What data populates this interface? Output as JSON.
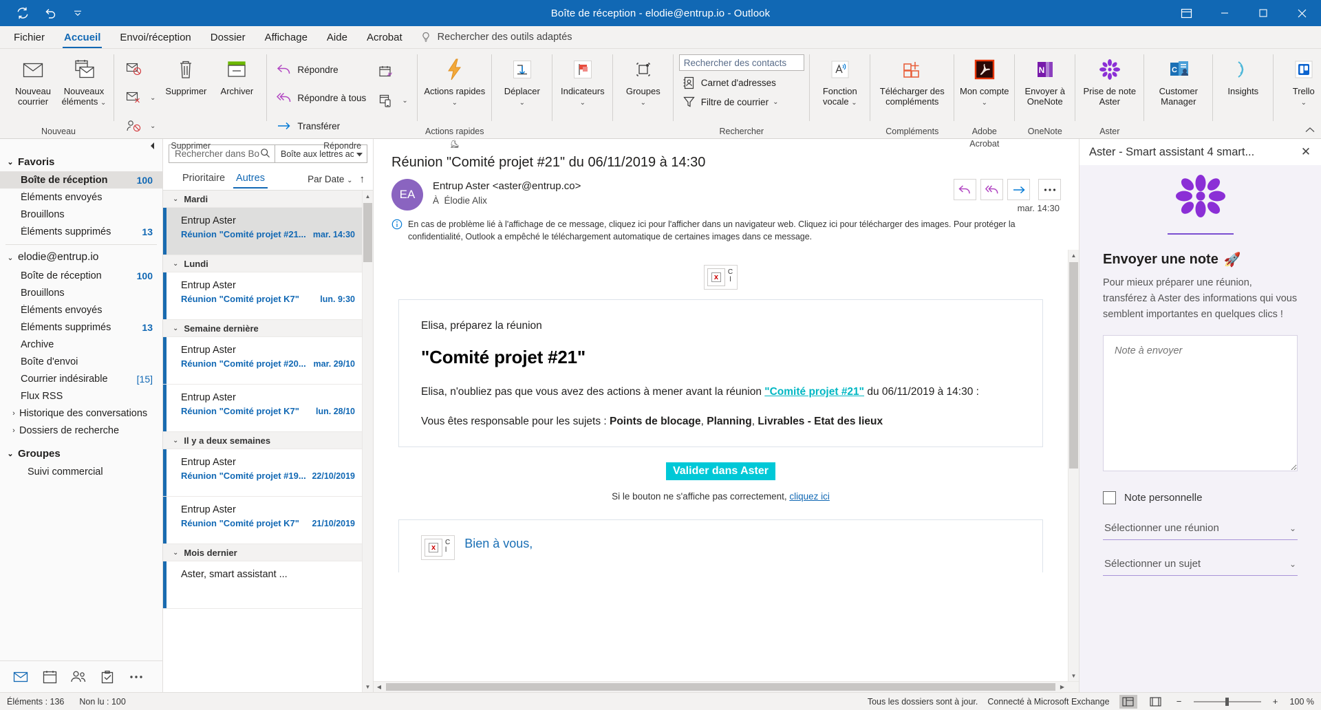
{
  "titlebar": {
    "title": "Boîte de réception - elodie@entrup.io  -  Outlook",
    "qat": {
      "sync": "sync-icon",
      "undo": "undo-icon",
      "more": "customize-quick-access-toolbar"
    },
    "controls": {
      "ribbon_display": "ribbon-display-options",
      "minimize": "minimize",
      "restore": "restore",
      "close": "close"
    }
  },
  "menubar": {
    "items": [
      {
        "label": "Fichier",
        "active": false
      },
      {
        "label": "Accueil",
        "active": true
      },
      {
        "label": "Envoi/réception",
        "active": false
      },
      {
        "label": "Dossier",
        "active": false
      },
      {
        "label": "Affichage",
        "active": false
      },
      {
        "label": "Aide",
        "active": false
      },
      {
        "label": "Acrobat",
        "active": false
      }
    ],
    "tell_me": "Rechercher des outils adaptés"
  },
  "ribbon": {
    "groups": [
      {
        "label": "Nouveau",
        "buttons": [
          {
            "label": "Nouveau courrier",
            "icon": "new-mail-icon"
          },
          {
            "label": "Nouveaux éléments",
            "icon": "new-items-icon",
            "dropdown": true
          }
        ]
      },
      {
        "label": "Supprimer",
        "buttons": [
          {
            "label": "Supprimer",
            "icon": "trash-icon"
          },
          {
            "label": "Archiver",
            "icon": "archive-icon"
          }
        ],
        "small": [
          {
            "label": "",
            "icon": "ignore-icon"
          },
          {
            "label": "",
            "icon": "junk-icon",
            "dropdown": true
          },
          {
            "label": "",
            "icon": "block-sender-icon",
            "dropdown": true
          }
        ]
      },
      {
        "label": "Répondre",
        "small": [
          {
            "label": "Répondre",
            "icon": "reply-icon"
          },
          {
            "label": "Répondre à tous",
            "icon": "reply-all-icon"
          },
          {
            "label": "Transférer",
            "icon": "forward-icon"
          }
        ],
        "stack": [
          {
            "icon": "meeting-reply-icon"
          },
          {
            "icon": "more-respond-icon",
            "dropdown": true
          }
        ]
      },
      {
        "label": "Actions rapides",
        "buttons": [
          {
            "label": "Actions rapides",
            "icon": "quick-steps-icon",
            "dropdown": true
          }
        ],
        "dialog_launcher": true
      },
      {
        "label": "",
        "buttons": [
          {
            "label": "Déplacer",
            "icon": "move-icon",
            "dropdown": true
          }
        ]
      },
      {
        "label": "",
        "buttons": [
          {
            "label": "Indicateurs",
            "icon": "flag-icon",
            "dropdown": true
          }
        ]
      },
      {
        "label": "",
        "buttons": [
          {
            "label": "Groupes",
            "icon": "groups-icon",
            "dropdown": true
          }
        ]
      },
      {
        "label": "Rechercher",
        "search_contacts_placeholder": "Rechercher des contacts",
        "small": [
          {
            "label": "Carnet d'adresses",
            "icon": "address-book-icon"
          },
          {
            "label": "Filtre de courrier",
            "icon": "filter-icon",
            "dropdown": true
          }
        ]
      },
      {
        "label": "",
        "buttons": [
          {
            "label": "Fonction vocale",
            "icon": "speech-icon",
            "dropdown": true
          }
        ]
      },
      {
        "label": "Compléments",
        "buttons": [
          {
            "label": "Télécharger des compléments",
            "icon": "get-addins-icon"
          }
        ]
      },
      {
        "label": "Adobe Acrobat",
        "buttons": [
          {
            "label": "Mon compte",
            "icon": "acrobat-icon",
            "dropdown": true
          }
        ]
      },
      {
        "label": "OneNote",
        "buttons": [
          {
            "label": "Envoyer à OneNote",
            "icon": "onenote-icon"
          }
        ]
      },
      {
        "label": "Aster",
        "buttons": [
          {
            "label": "Prise de note Aster",
            "icon": "aster-flower-icon"
          }
        ]
      },
      {
        "label": "",
        "buttons": [
          {
            "label": "Customer Manager",
            "icon": "customer-manager-icon"
          }
        ]
      },
      {
        "label": "",
        "buttons": [
          {
            "label": "Insights",
            "icon": "insights-icon"
          }
        ]
      },
      {
        "label": "",
        "buttons": [
          {
            "label": "Trello",
            "icon": "trello-icon",
            "dropdown": true
          }
        ]
      }
    ],
    "collapse": "collapse-ribbon-icon"
  },
  "folderpane": {
    "collapse_icon": "collapse-folder-pane-icon",
    "groups": [
      {
        "name": "Favoris",
        "expanded": true,
        "items": [
          {
            "label": "Boîte de réception",
            "count": "100",
            "selected": true
          },
          {
            "label": "Éléments envoyés",
            "count": ""
          },
          {
            "label": "Brouillons",
            "count": ""
          },
          {
            "label": "Éléments supprimés",
            "count": "13"
          }
        ]
      },
      {
        "name": "elodie@entrup.io",
        "expanded": true,
        "items": [
          {
            "label": "Boîte de réception",
            "count": "100"
          },
          {
            "label": "Brouillons",
            "count": ""
          },
          {
            "label": "Éléments envoyés",
            "count": ""
          },
          {
            "label": "Éléments supprimés",
            "count": "13"
          },
          {
            "label": "Archive",
            "count": ""
          },
          {
            "label": "Boîte d'envoi",
            "count": ""
          },
          {
            "label": "Courrier indésirable",
            "count": "[15]"
          },
          {
            "label": "Flux RSS",
            "count": ""
          },
          {
            "label": "Historique des conversations",
            "count": "",
            "expandable": true
          },
          {
            "label": "Dossiers de recherche",
            "count": "",
            "expandable": true
          }
        ]
      },
      {
        "name": "Groupes",
        "expanded": true,
        "items": [
          {
            "label": "Suivi commercial",
            "count": "",
            "sub": true
          }
        ]
      }
    ],
    "nav_buttons": [
      {
        "icon": "mail-nav-icon",
        "name": "mail"
      },
      {
        "icon": "calendar-nav-icon",
        "name": "calendar"
      },
      {
        "icon": "people-nav-icon",
        "name": "people"
      },
      {
        "icon": "tasks-nav-icon",
        "name": "tasks"
      },
      {
        "icon": "more-nav-icon",
        "name": "more"
      }
    ]
  },
  "messagelist": {
    "search_placeholder": "Rechercher dans Bo",
    "search_icon": "search-icon",
    "scope": "Boîte aux lettres actuelle",
    "tabs": [
      {
        "label": "Prioritaire",
        "active": false
      },
      {
        "label": "Autres",
        "active": true
      }
    ],
    "sort_by": "Par Date",
    "sort_direction_icon": "sort-ascending-icon",
    "groups": [
      {
        "day": "Mardi",
        "items": [
          {
            "sender": "Entrup Aster",
            "subject": "Réunion \"Comité projet #21...",
            "date": "mar. 14:30",
            "selected": true
          }
        ]
      },
      {
        "day": "Lundi",
        "items": [
          {
            "sender": "Entrup Aster",
            "subject": "Réunion \"Comité projet K7\"",
            "date": "lun. 9:30",
            "selected": false
          }
        ]
      },
      {
        "day": "Semaine dernière",
        "items": [
          {
            "sender": "Entrup Aster",
            "subject": "Réunion \"Comité projet #20...",
            "date": "mar. 29/10",
            "selected": false
          },
          {
            "sender": "Entrup Aster",
            "subject": "Réunion \"Comité projet K7\"",
            "date": "lun. 28/10",
            "selected": false
          }
        ]
      },
      {
        "day": "Il y a deux semaines",
        "items": [
          {
            "sender": "Entrup Aster",
            "subject": "Réunion \"Comité projet #19...",
            "date": "22/10/2019",
            "selected": false
          },
          {
            "sender": "Entrup Aster",
            "subject": "Réunion \"Comité projet K7\"",
            "date": "21/10/2019",
            "selected": false
          }
        ]
      },
      {
        "day": "Mois dernier",
        "items": [
          {
            "sender": "Aster, smart assistant ...",
            "subject": "",
            "date": "",
            "selected": false
          }
        ]
      }
    ]
  },
  "readingpane": {
    "subject": "Réunion \"Comité projet #21\" du 06/11/2019 à 14:30",
    "avatar_initials": "EA",
    "from": "Entrup Aster <aster@entrup.co>",
    "to_prefix": "À",
    "to": "Élodie Alix",
    "timestamp": "mar. 14:30",
    "actions": [
      {
        "name": "reply-button",
        "icon": "reply-icon"
      },
      {
        "name": "reply-all-button",
        "icon": "reply-all-icon"
      },
      {
        "name": "forward-button",
        "icon": "forward-icon"
      },
      {
        "name": "more-actions-button",
        "icon": "ellipsis-icon"
      }
    ],
    "infobar": "En cas de problème lié à l'affichage de ce message, cliquez ici pour l'afficher dans un navigateur web. Cliquez ici pour télécharger des images. Pour protéger la confidentialité, Outlook a empêché le téléchargement automatique de certaines images dans ce message.",
    "blocked_image_label_1": "C",
    "blocked_image_label_2": "l",
    "body": {
      "greeting": "Elisa, préparez la réunion",
      "heading": "\"Comité projet #21\"",
      "para1_before": "Elisa, n'oubliez pas que vous avez des actions à mener avant la réunion ",
      "para1_link": "\"Comité projet #21\"",
      "para1_after": " du 06/11/2019 à 14:30 :",
      "para2_before": "Vous êtes responsable pour les sujets : ",
      "para2_bold1": "Points de blocage",
      "para2_mid": ", ",
      "para2_bold2": "Planning",
      "para2_mid2": ", ",
      "para2_bold3": "Livrables - Etat des lieux",
      "cta": "Valider dans Aster",
      "footnote_before": "Si le bouton ne s'affiche pas correctement, ",
      "footnote_link": "cliquez ici",
      "signoff": "Bien à vous,"
    }
  },
  "asterpane": {
    "title": "Aster - Smart assistant 4 smart...",
    "close_icon": "close-icon",
    "logo": "aster-flower-logo",
    "heading": "Envoyer une note",
    "heading_icon": "rocket-icon",
    "description": "Pour mieux préparer une réunion, transférez à Aster des informations qui vous semblent importantes en quelques clics !",
    "note_placeholder": "Note à envoyer",
    "checkbox_label": "Note personnelle",
    "checkbox_checked": false,
    "select_meeting": "Sélectionner une réunion",
    "select_subject": "Sélectionner un sujet",
    "chevron_icon": "chevron-down-icon"
  },
  "statusbar": {
    "items_count": "Éléments : 136",
    "unread_count": "Non lu : 100",
    "sync_status": "Tous les dossiers sont à jour.",
    "connection": "Connecté à Microsoft Exchange",
    "view_normal": "normal-view-icon",
    "view_reading": "reading-view-icon",
    "zoom_out": "−",
    "zoom_in": "+",
    "zoom_level": "100 %"
  }
}
